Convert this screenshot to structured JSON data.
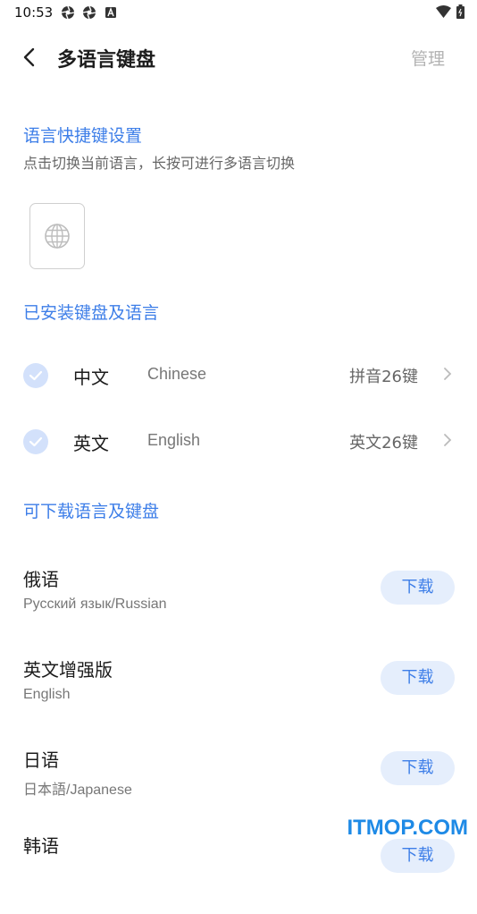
{
  "status_bar": {
    "time": "10:53"
  },
  "header": {
    "title": "多语言键盘",
    "manage_label": "管理"
  },
  "shortcut_section": {
    "title": "语言快捷键设置",
    "description": "点击切换当前语言，长按可进行多语言切换",
    "key_icon": "globe-icon"
  },
  "installed_section": {
    "title": "已安装键盘及语言",
    "items": [
      {
        "name": "中文",
        "english": "Chinese",
        "layout": "拼音26键",
        "checked": true
      },
      {
        "name": "英文",
        "english": "English",
        "layout": "英文26键",
        "checked": true
      }
    ]
  },
  "download_section": {
    "title": "可下载语言及键盘",
    "button_label": "下载",
    "items": [
      {
        "name": "俄语",
        "subtitle": "Русский язык/Russian"
      },
      {
        "name": "英文增强版",
        "subtitle": "English"
      },
      {
        "name": "日语",
        "subtitle": "日本語/Japanese"
      },
      {
        "name": "韩语",
        "subtitle": ""
      }
    ]
  },
  "colors": {
    "accent": "#3d7ee8",
    "check_bg": "#d3e1fb",
    "button_bg": "#e5eefc"
  },
  "watermark": "ITMOP.COM"
}
